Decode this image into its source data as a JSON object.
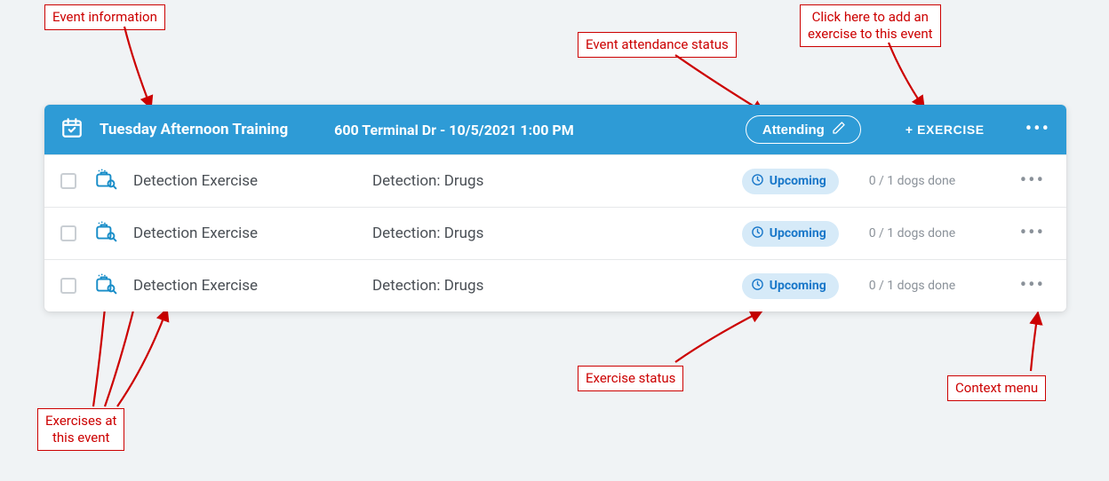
{
  "annotations": {
    "event_info": "Event information",
    "attendance_status": "Event attendance status",
    "add_exercise_hint": "Click here to add an\nexercise to this event",
    "exercises_here": "Exercises at\nthis event",
    "exercise_status": "Exercise status",
    "context_menu": "Context menu"
  },
  "header": {
    "title": "Tuesday Afternoon Training",
    "subtitle": "600 Terminal Dr - 10/5/2021 1:00 PM",
    "attend_label": "Attending",
    "add_exercise_label": "+ EXERCISE"
  },
  "rows": [
    {
      "name": "Detection Exercise",
      "category": "Detection: Drugs",
      "status": "Upcoming",
      "progress": "0 / 1 dogs done"
    },
    {
      "name": "Detection Exercise",
      "category": "Detection: Drugs",
      "status": "Upcoming",
      "progress": "0 / 1 dogs done"
    },
    {
      "name": "Detection Exercise",
      "category": "Detection: Drugs",
      "status": "Upcoming",
      "progress": "0 / 1 dogs done"
    }
  ]
}
